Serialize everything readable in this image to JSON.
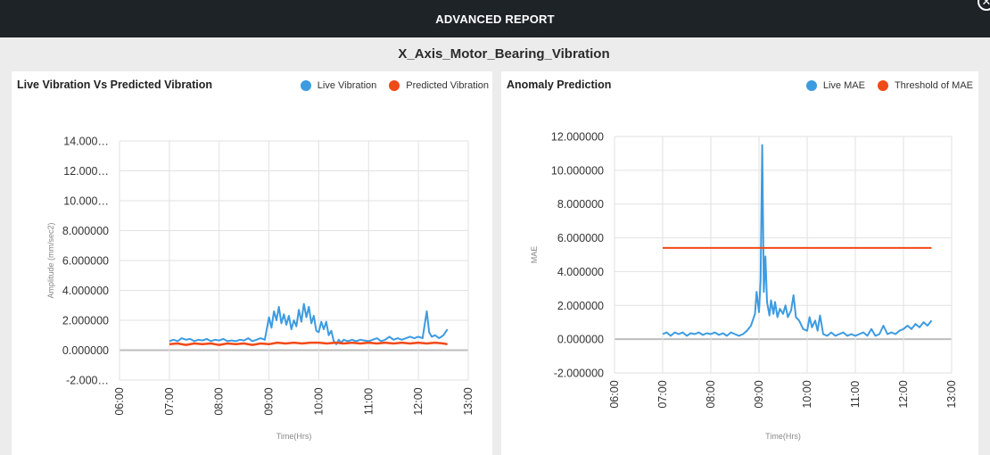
{
  "window": {
    "title": "ADVANCED REPORT",
    "close_glyph": "✕",
    "close_icon": "close-circle-icon"
  },
  "report": {
    "title": "X_Axis_Motor_Bearing_Vibration"
  },
  "colors": {
    "blue": "#3d9be0",
    "orange": "#f04a17",
    "grid": "#e2e2e2",
    "zero_line": "#bdbdbd"
  },
  "panels": {
    "left": {
      "title": "Live Vibration Vs Predicted Vibration",
      "legend": [
        "Live Vibration",
        "Predicted Vibration"
      ]
    },
    "right": {
      "title": "Anomaly Prediction",
      "legend": [
        "Live MAE",
        "Threshold of MAE"
      ]
    }
  },
  "chart_data": [
    {
      "type": "line",
      "title": "Live Vibration Vs Predicted Vibration",
      "xlabel": "Time(Hrs)",
      "ylabel": "Amplitude (mm/sec2)",
      "x_ticks": [
        "06:00",
        "07:00",
        "08:00",
        "09:00",
        "10:00",
        "11:00",
        "12:00",
        "13:00"
      ],
      "y_ticks": [
        "-2.000…",
        "0.000000",
        "2.000000",
        "4.000000",
        "6.000000",
        "8.000000",
        "10.000…",
        "12.000…",
        "14.000…"
      ],
      "ylim": [
        -2,
        14
      ],
      "xlim": [
        "06:00",
        "13:00"
      ],
      "grid": true,
      "legend_position": "top-right",
      "series": [
        {
          "name": "Live Vibration",
          "color": "#3d9be0",
          "points": [
            [
              "07:00",
              0.6
            ],
            [
              "07:05",
              0.7
            ],
            [
              "07:10",
              0.6
            ],
            [
              "07:15",
              0.8
            ],
            [
              "07:20",
              0.7
            ],
            [
              "07:25",
              0.75
            ],
            [
              "07:30",
              0.6
            ],
            [
              "07:35",
              0.7
            ],
            [
              "07:40",
              0.65
            ],
            [
              "07:45",
              0.75
            ],
            [
              "07:50",
              0.6
            ],
            [
              "07:55",
              0.7
            ],
            [
              "08:00",
              0.65
            ],
            [
              "08:05",
              0.75
            ],
            [
              "08:10",
              0.6
            ],
            [
              "08:15",
              0.65
            ],
            [
              "08:20",
              0.6
            ],
            [
              "08:25",
              0.7
            ],
            [
              "08:30",
              0.65
            ],
            [
              "08:35",
              0.8
            ],
            [
              "08:40",
              0.6
            ],
            [
              "08:45",
              0.7
            ],
            [
              "08:50",
              0.8
            ],
            [
              "08:55",
              0.7
            ],
            [
              "09:00",
              2.2
            ],
            [
              "09:03",
              1.5
            ],
            [
              "09:06",
              2.6
            ],
            [
              "09:09",
              2.0
            ],
            [
              "09:12",
              2.9
            ],
            [
              "09:15",
              1.8
            ],
            [
              "09:18",
              2.4
            ],
            [
              "09:21",
              1.7
            ],
            [
              "09:24",
              2.3
            ],
            [
              "09:27",
              1.4
            ],
            [
              "09:30",
              2.0
            ],
            [
              "09:33",
              1.6
            ],
            [
              "09:36",
              2.7
            ],
            [
              "09:39",
              1.9
            ],
            [
              "09:42",
              3.1
            ],
            [
              "09:45",
              2.2
            ],
            [
              "09:48",
              2.9
            ],
            [
              "09:51",
              1.8
            ],
            [
              "09:54",
              2.3
            ],
            [
              "09:57",
              1.3
            ],
            [
              "10:00",
              1.2
            ],
            [
              "10:03",
              1.9
            ],
            [
              "10:06",
              1.4
            ],
            [
              "10:09",
              1.9
            ],
            [
              "10:12",
              1.0
            ],
            [
              "10:15",
              1.3
            ],
            [
              "10:18",
              0.6
            ],
            [
              "10:21",
              0.4
            ],
            [
              "10:24",
              0.7
            ],
            [
              "10:27",
              0.5
            ],
            [
              "10:30",
              0.7
            ],
            [
              "10:35",
              0.6
            ],
            [
              "10:40",
              0.7
            ],
            [
              "10:45",
              0.6
            ],
            [
              "10:50",
              0.7
            ],
            [
              "10:55",
              0.65
            ],
            [
              "11:00",
              0.6
            ],
            [
              "11:05",
              0.7
            ],
            [
              "11:10",
              0.8
            ],
            [
              "11:15",
              0.6
            ],
            [
              "11:20",
              0.7
            ],
            [
              "11:25",
              0.9
            ],
            [
              "11:30",
              0.7
            ],
            [
              "11:35",
              0.8
            ],
            [
              "11:40",
              0.7
            ],
            [
              "11:45",
              0.8
            ],
            [
              "11:50",
              0.9
            ],
            [
              "11:55",
              0.8
            ],
            [
              "12:00",
              0.9
            ],
            [
              "12:05",
              0.8
            ],
            [
              "12:10",
              2.6
            ],
            [
              "12:13",
              1.2
            ],
            [
              "12:16",
              0.9
            ],
            [
              "12:20",
              1.0
            ],
            [
              "12:25",
              0.8
            ],
            [
              "12:30",
              1.0
            ],
            [
              "12:35",
              1.4
            ]
          ]
        },
        {
          "name": "Predicted Vibration",
          "color": "#f04a17",
          "points": [
            [
              "07:00",
              0.4
            ],
            [
              "07:10",
              0.45
            ],
            [
              "07:20",
              0.35
            ],
            [
              "07:30",
              0.45
            ],
            [
              "07:40",
              0.4
            ],
            [
              "07:50",
              0.45
            ],
            [
              "08:00",
              0.35
            ],
            [
              "08:10",
              0.45
            ],
            [
              "08:20",
              0.4
            ],
            [
              "08:30",
              0.45
            ],
            [
              "08:40",
              0.35
            ],
            [
              "08:50",
              0.45
            ],
            [
              "09:00",
              0.4
            ],
            [
              "09:10",
              0.5
            ],
            [
              "09:20",
              0.45
            ],
            [
              "09:30",
              0.5
            ],
            [
              "09:40",
              0.45
            ],
            [
              "09:50",
              0.5
            ],
            [
              "10:00",
              0.5
            ],
            [
              "10:10",
              0.45
            ],
            [
              "10:20",
              0.5
            ],
            [
              "10:30",
              0.45
            ],
            [
              "10:40",
              0.5
            ],
            [
              "10:50",
              0.45
            ],
            [
              "11:00",
              0.5
            ],
            [
              "11:10",
              0.45
            ],
            [
              "11:20",
              0.5
            ],
            [
              "11:30",
              0.45
            ],
            [
              "11:40",
              0.5
            ],
            [
              "11:50",
              0.45
            ],
            [
              "12:00",
              0.5
            ],
            [
              "12:10",
              0.45
            ],
            [
              "12:20",
              0.5
            ],
            [
              "12:30",
              0.45
            ],
            [
              "12:35",
              0.4
            ]
          ]
        }
      ]
    },
    {
      "type": "line",
      "title": "Anomaly Prediction",
      "xlabel": "Time(Hrs)",
      "ylabel": "MAE",
      "x_ticks": [
        "06:00",
        "07:00",
        "08:00",
        "09:00",
        "10:00",
        "11:00",
        "12:00",
        "13:00"
      ],
      "y_ticks": [
        "-2.000000",
        "0.000000",
        "2.000000",
        "4.000000",
        "6.000000",
        "8.000000",
        "10.000000",
        "12.000000"
      ],
      "ylim": [
        -2,
        12
      ],
      "xlim": [
        "06:00",
        "13:00"
      ],
      "grid": true,
      "legend_position": "top-right",
      "series": [
        {
          "name": "Live MAE",
          "color": "#3d9be0",
          "points": [
            [
              "07:00",
              0.3
            ],
            [
              "07:05",
              0.4
            ],
            [
              "07:10",
              0.2
            ],
            [
              "07:15",
              0.4
            ],
            [
              "07:20",
              0.3
            ],
            [
              "07:25",
              0.4
            ],
            [
              "07:30",
              0.2
            ],
            [
              "07:35",
              0.35
            ],
            [
              "07:40",
              0.3
            ],
            [
              "07:45",
              0.4
            ],
            [
              "07:50",
              0.25
            ],
            [
              "07:55",
              0.35
            ],
            [
              "08:00",
              0.3
            ],
            [
              "08:05",
              0.4
            ],
            [
              "08:10",
              0.25
            ],
            [
              "08:15",
              0.35
            ],
            [
              "08:20",
              0.2
            ],
            [
              "08:25",
              0.4
            ],
            [
              "08:30",
              0.3
            ],
            [
              "08:35",
              0.2
            ],
            [
              "08:40",
              0.3
            ],
            [
              "08:45",
              0.5
            ],
            [
              "08:50",
              0.8
            ],
            [
              "08:55",
              1.5
            ],
            [
              "08:57",
              2.8
            ],
            [
              "09:00",
              1.6
            ],
            [
              "09:02",
              3.5
            ],
            [
              "09:04",
              11.5
            ],
            [
              "09:06",
              2.8
            ],
            [
              "09:08",
              4.9
            ],
            [
              "09:10",
              2.2
            ],
            [
              "09:13",
              1.4
            ],
            [
              "09:15",
              2.3
            ],
            [
              "09:18",
              1.5
            ],
            [
              "09:20",
              2.2
            ],
            [
              "09:23",
              1.3
            ],
            [
              "09:26",
              1.8
            ],
            [
              "09:30",
              1.5
            ],
            [
              "09:33",
              2.0
            ],
            [
              "09:36",
              1.3
            ],
            [
              "09:40",
              1.7
            ],
            [
              "09:43",
              2.6
            ],
            [
              "09:46",
              1.3
            ],
            [
              "09:50",
              1.1
            ],
            [
              "09:55",
              0.6
            ],
            [
              "10:00",
              0.5
            ],
            [
              "10:03",
              1.3
            ],
            [
              "10:06",
              0.7
            ],
            [
              "10:10",
              1.1
            ],
            [
              "10:13",
              0.5
            ],
            [
              "10:16",
              1.4
            ],
            [
              "10:20",
              0.3
            ],
            [
              "10:25",
              0.2
            ],
            [
              "10:30",
              0.4
            ],
            [
              "10:35",
              0.2
            ],
            [
              "10:40",
              0.3
            ],
            [
              "10:45",
              0.4
            ],
            [
              "10:50",
              0.2
            ],
            [
              "10:55",
              0.3
            ],
            [
              "11:00",
              0.2
            ],
            [
              "11:05",
              0.3
            ],
            [
              "11:10",
              0.4
            ],
            [
              "11:15",
              0.2
            ],
            [
              "11:20",
              0.6
            ],
            [
              "11:25",
              0.2
            ],
            [
              "11:30",
              0.3
            ],
            [
              "11:35",
              0.8
            ],
            [
              "11:40",
              0.3
            ],
            [
              "11:45",
              0.4
            ],
            [
              "11:50",
              0.3
            ],
            [
              "11:55",
              0.5
            ],
            [
              "12:00",
              0.6
            ],
            [
              "12:05",
              0.8
            ],
            [
              "12:10",
              0.6
            ],
            [
              "12:15",
              0.9
            ],
            [
              "12:20",
              0.7
            ],
            [
              "12:25",
              1.0
            ],
            [
              "12:30",
              0.8
            ],
            [
              "12:35",
              1.1
            ]
          ]
        },
        {
          "name": "Threshold of MAE",
          "color": "#f04a17",
          "points": [
            [
              "07:00",
              5.4
            ],
            [
              "12:35",
              5.4
            ]
          ]
        }
      ]
    }
  ]
}
